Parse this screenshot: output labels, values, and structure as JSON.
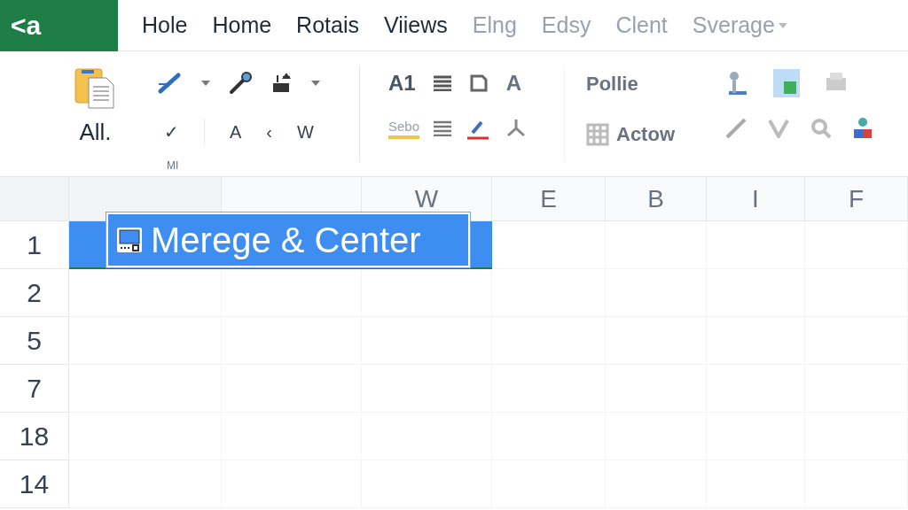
{
  "app_logo": "<a",
  "tabs": [
    {
      "label": "Hole",
      "disabled": false
    },
    {
      "label": "Home",
      "disabled": false
    },
    {
      "label": "Rotais",
      "disabled": false
    },
    {
      "label": "Viiews",
      "disabled": false
    },
    {
      "label": "Elng",
      "disabled": true
    },
    {
      "label": "Edsy",
      "disabled": true
    },
    {
      "label": "Clent",
      "disabled": true
    },
    {
      "label": "Sverage",
      "disabled": true
    }
  ],
  "ribbon": {
    "paste_label": "All.",
    "row2_glyphs": [
      "✓",
      "A",
      "‹",
      "W"
    ],
    "cell_ref": "A1",
    "font_letter": "A",
    "style_box": "Sebo",
    "dropdown_1": "Pollie",
    "dropdown_2": "Actow",
    "group_label": "MI"
  },
  "sheet": {
    "columns": [
      "W",
      "E",
      "B",
      "I",
      "F"
    ],
    "rows": [
      "1",
      "2",
      "5",
      "7",
      "18",
      "14"
    ],
    "popup": "Merege & Center"
  }
}
